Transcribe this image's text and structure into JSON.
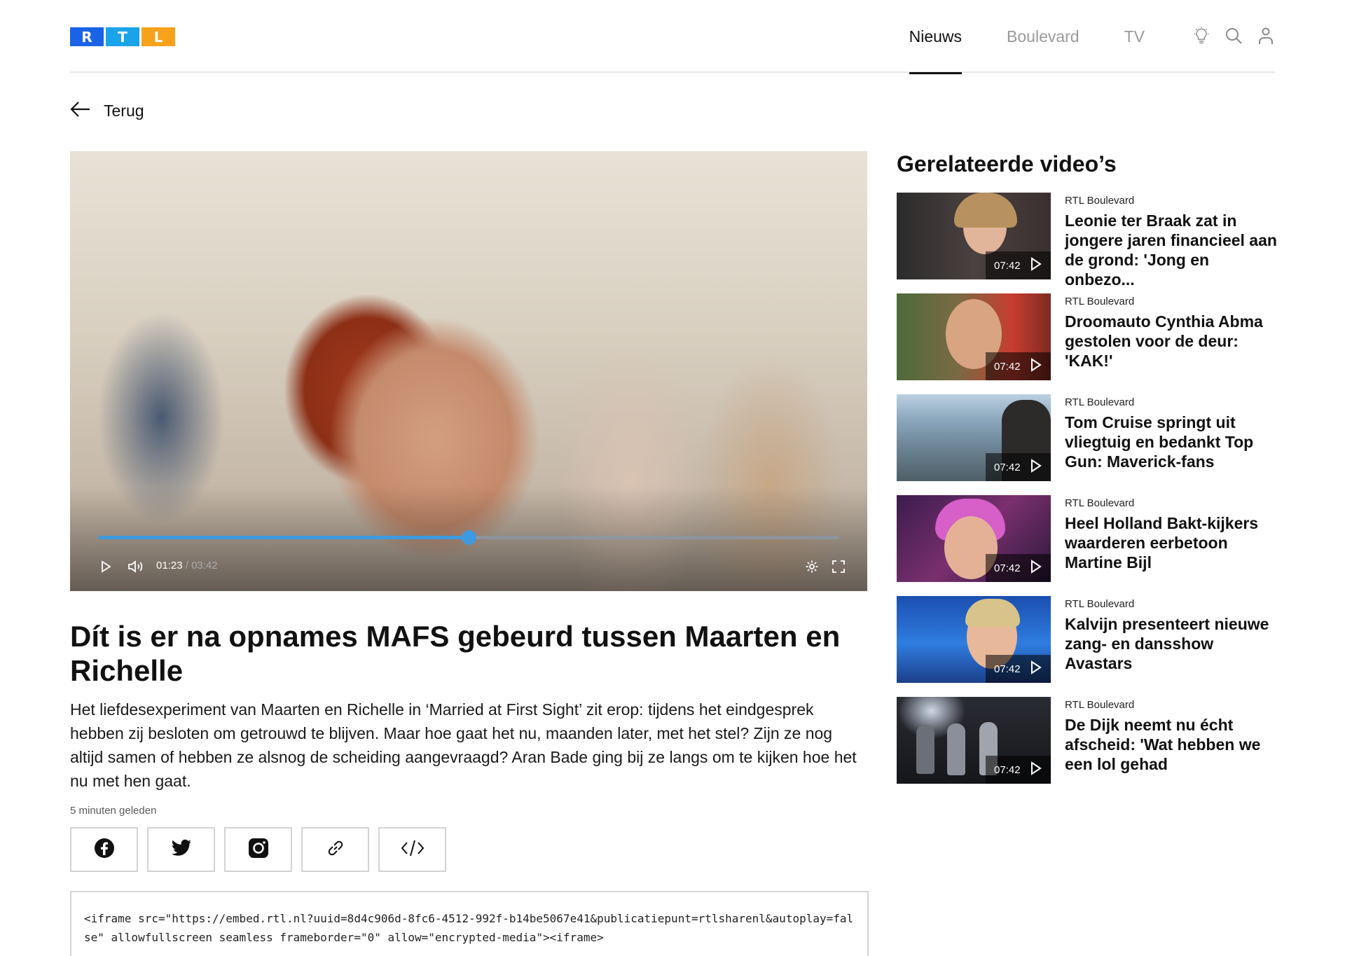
{
  "header": {
    "logo_letters": [
      "R",
      "T",
      "L"
    ],
    "logo_colors": [
      "#1a63e6",
      "#1aa3e8",
      "#f7a21b"
    ],
    "nav": [
      {
        "label": "Nieuws",
        "active": true
      },
      {
        "label": "Boulevard",
        "active": false
      },
      {
        "label": "TV",
        "active": false
      }
    ],
    "icons": [
      "lightbulb-icon",
      "search-icon",
      "user-icon"
    ]
  },
  "back": {
    "label": "Terug",
    "icon": "arrow-left-icon"
  },
  "player": {
    "current_time": "01:23",
    "separator": "/",
    "duration": "03:42",
    "progress_fraction": 0.5,
    "accent_color": "#3d9ae0",
    "controls": [
      "play-icon",
      "volume-icon",
      "settings-icon",
      "fullscreen-icon"
    ]
  },
  "article": {
    "title": "Dít is er na opnames MAFS gebeurd tussen Maarten en Richelle",
    "description": "Het liefdesexperiment van Maarten en Richelle in ‘Married at First Sight’ zit erop: tijdens het eindgesprek hebben zij besloten om getrouwd te blijven. Maar hoe gaat het nu, maanden later, met het stel? Zijn ze nog altijd samen of hebben ze alsnog de scheiding aangevraagd? Aran Bade ging bij ze langs om te kijken hoe het nu met hen gaat.",
    "timestamp": "5 minuten geleden",
    "share_icons": [
      "facebook-icon",
      "twitter-icon",
      "instagram-icon",
      "link-icon",
      "embed-code-icon"
    ],
    "embed_code": "<iframe src=\"https://embed.rtl.nl?uuid=8d4c906d-8fc6-4512-992f-b14be5067e41&publicatiepunt=rtlsharenl&autoplay=false\" allowfullscreen seamless frameborder=\"0\" allow=\"encrypted-media\"><iframe>"
  },
  "related": {
    "title": "Gerelateerde video’s",
    "items": [
      {
        "source": "RTL Boulevard",
        "headline": "Leonie ter Braak zat in jongere jaren financieel aan de grond: 'Jong en onbezo...",
        "duration": "07:42"
      },
      {
        "source": "RTL Boulevard",
        "headline": "Droomauto Cynthia Abma gestolen voor de deur: 'KAK!'",
        "duration": "07:42"
      },
      {
        "source": "RTL Boulevard",
        "headline": "Tom Cruise springt uit vliegtuig en bedankt Top Gun: Maverick-fans",
        "duration": "07:42"
      },
      {
        "source": "RTL Boulevard",
        "headline": "Heel Holland Bakt-kijkers waarderen eerbetoon Martine Bijl",
        "duration": "07:42"
      },
      {
        "source": "RTL Boulevard",
        "headline": "Kalvijn presenteert nieuwe zang- en dansshow Avastars",
        "duration": "07:42"
      },
      {
        "source": "RTL Boulevard",
        "headline": "De Dijk neemt nu écht afscheid: 'Wat hebben we een lol gehad",
        "duration": "07:42"
      }
    ]
  }
}
